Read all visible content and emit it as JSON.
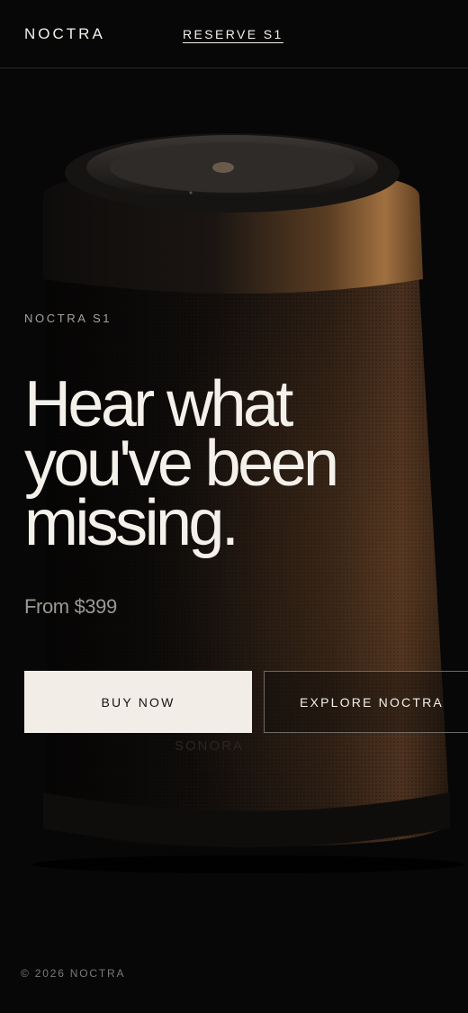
{
  "header": {
    "brand": "NOCTRA",
    "reserve_link": "RESERVE S1"
  },
  "hero": {
    "eyebrow": "NOCTRA S1",
    "headline_lines": [
      "Hear what",
      "you've been",
      "missing."
    ],
    "price": "From $399",
    "product_logo": "SONORA"
  },
  "actions": {
    "buy_label": "BUY NOW",
    "explore_label": "EXPLORE NOCTRA"
  },
  "footer": {
    "copyright": "© 2026 NOCTRA"
  },
  "colors": {
    "background": "#070707",
    "text": "#f3efe9",
    "button_primary": "#f2ede7",
    "bronze_accent": "#9a6a38"
  }
}
